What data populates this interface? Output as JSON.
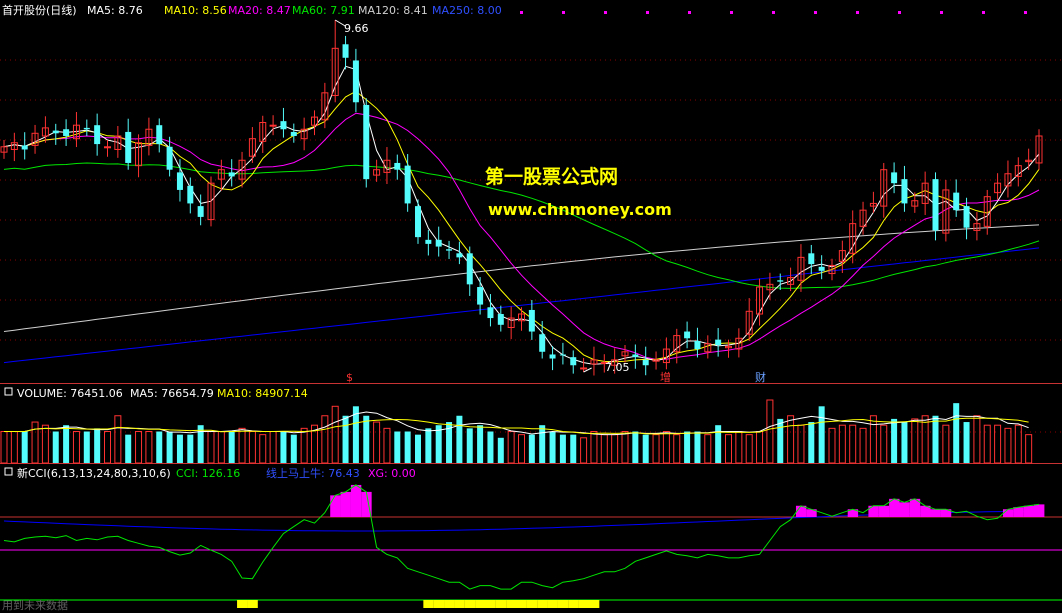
{
  "colors": {
    "bg": "#000000",
    "up": "#ff3232",
    "down": "#54fcfc",
    "ma5": "#ffffff",
    "ma10": "#ffff00",
    "ma20": "#ff00ff",
    "ma60": "#00e600",
    "ma120": "#d0d0d0",
    "ma250": "#0000ff",
    "grid": "#8b0000",
    "divider": "#c83232",
    "watermark": "#ffff00",
    "cci": "#00e600",
    "cci_hist_hi": "#ff00ff",
    "cci_hist_lo": "#ffff00",
    "xg_line": "#0000ff",
    "level_line_top": "#c83232",
    "level_line_mid": "#ff00ff",
    "level_line_bot": "#00ff00"
  },
  "price_panel": {
    "stock_name": "首开股份(日线)",
    "ma5": "MA5: 8.76",
    "ma10": "MA10: 8.56",
    "ma20": "MA20: 8.47",
    "ma60": "MA60: 7.91",
    "ma120": "MA120: 8.41",
    "ma250": "MA250: 8.00",
    "high_label": "9.66",
    "low_label": "7.05",
    "marker_s": "$",
    "marker_zeng": "增",
    "marker_cai": "财"
  },
  "watermark": {
    "line1": "第一股票公式网",
    "line2": "www.chnmoney.com"
  },
  "volume_panel": {
    "title": "VOLUME: 76451.06",
    "ma5": "MA5: 76654.79",
    "ma10": "MA10: 84907.14"
  },
  "cci_panel": {
    "title": "新CCI(6,13,13,24,80,3,10,6)",
    "cci": "CCI: 126.16",
    "line_name": "线上马上牛: 76.43",
    "xg": "XG: 0.00",
    "footer": "用到未来数据"
  },
  "chart_data": [
    {
      "type": "candlestick",
      "closes": [
        8.72,
        8.75,
        8.7,
        8.82,
        8.86,
        8.82,
        8.8,
        8.88,
        8.85,
        8.74,
        8.72,
        8.8,
        8.6,
        8.75,
        8.85,
        8.74,
        8.55,
        8.4,
        8.3,
        8.2,
        8.45,
        8.55,
        8.5,
        8.62,
        8.78,
        8.9,
        8.88,
        8.85,
        8.8,
        8.85,
        8.94,
        9.12,
        9.45,
        9.38,
        9.05,
        8.48,
        8.55,
        8.62,
        8.55,
        8.3,
        8.05,
        8.0,
        7.98,
        7.95,
        7.9,
        7.7,
        7.55,
        7.45,
        7.4,
        7.45,
        7.48,
        7.35,
        7.2,
        7.15,
        7.18,
        7.1,
        7.08,
        7.14,
        7.12,
        7.14,
        7.2,
        7.16,
        7.1,
        7.14,
        7.22,
        7.32,
        7.3,
        7.22,
        7.26,
        7.25,
        7.24,
        7.3,
        7.5,
        7.68,
        7.7,
        7.72,
        7.75,
        7.9,
        7.85,
        7.8,
        7.84,
        7.95,
        8.15,
        8.25,
        8.3,
        8.55,
        8.45,
        8.3,
        8.32,
        8.45,
        8.1,
        8.4,
        8.25,
        8.12,
        8.15,
        8.35,
        8.45,
        8.52,
        8.58,
        8.62,
        8.8
      ],
      "ylim": [
        7.05,
        9.66
      ],
      "y_extremes": {
        "high": 9.66,
        "low": 7.05
      }
    },
    {
      "type": "bar",
      "title": "VOLUME",
      "values": [
        50,
        50,
        50,
        65,
        60,
        50,
        60,
        50,
        50,
        55,
        50,
        75,
        45,
        50,
        50,
        50,
        50,
        45,
        45,
        60,
        50,
        50,
        50,
        55,
        50,
        45,
        50,
        50,
        45,
        55,
        60,
        75,
        90,
        75,
        90,
        75,
        65,
        55,
        50,
        50,
        45,
        55,
        60,
        65,
        75,
        55,
        60,
        50,
        40,
        50,
        45,
        45,
        60,
        50,
        45,
        45,
        40,
        50,
        45,
        45,
        50,
        50,
        45,
        45,
        50,
        45,
        50,
        50,
        45,
        60,
        45,
        50,
        45,
        50,
        100,
        70,
        75,
        60,
        65,
        90,
        55,
        60,
        60,
        55,
        75,
        60,
        70,
        65,
        70,
        75,
        75,
        60,
        95,
        65,
        75,
        60,
        60,
        55,
        60,
        45
      ]
    },
    {
      "type": "line",
      "title": "新CCI",
      "values": [
        30,
        28,
        33,
        35,
        36,
        34,
        37,
        30,
        33,
        31,
        35,
        36,
        30,
        26,
        22,
        20,
        14,
        9,
        12,
        23,
        16,
        10,
        0,
        -24,
        -25,
        -1,
        20,
        40,
        50,
        60,
        55,
        70,
        95,
        100,
        110,
        100,
        20,
        10,
        5,
        -10,
        -15,
        -20,
        -25,
        -30,
        -30,
        -40,
        -35,
        -35,
        -40,
        -40,
        -30,
        -30,
        -35,
        -38,
        -30,
        -28,
        -25,
        -20,
        -15,
        -15,
        -10,
        0,
        5,
        10,
        15,
        10,
        8,
        5,
        10,
        8,
        5,
        5,
        8,
        10,
        30,
        50,
        60,
        80,
        75,
        70,
        65,
        70,
        75,
        70,
        80,
        80,
        90,
        85,
        90,
        80,
        75,
        75,
        70,
        72,
        65,
        60,
        62,
        75,
        78,
        80,
        82
      ]
    }
  ]
}
